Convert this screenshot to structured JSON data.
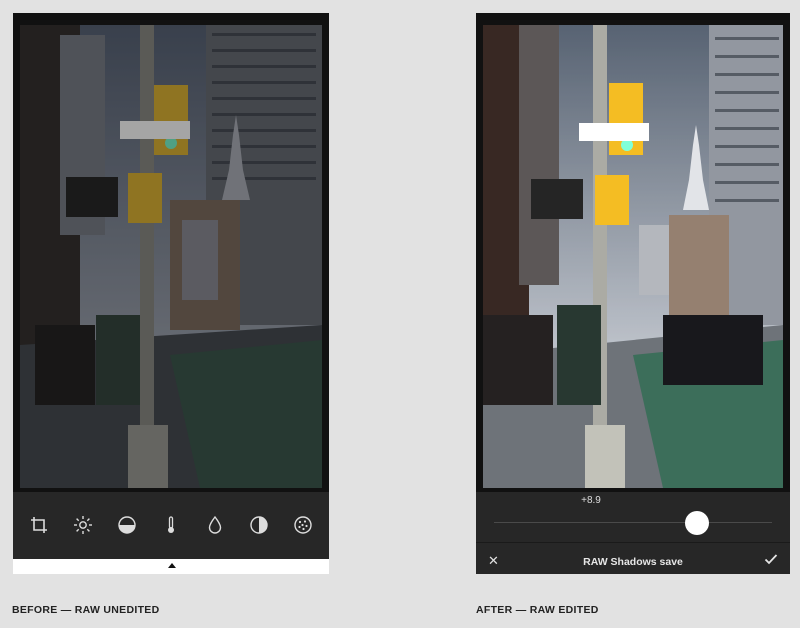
{
  "before_panel": {
    "caption": "BEFORE — RAW UNEDITED",
    "tools": [
      {
        "name": "crop-icon"
      },
      {
        "name": "brightness-icon"
      },
      {
        "name": "exposure-icon"
      },
      {
        "name": "temperature-icon"
      },
      {
        "name": "saturation-icon"
      },
      {
        "name": "contrast-icon"
      },
      {
        "name": "grain-icon"
      }
    ]
  },
  "after_panel": {
    "caption": "AFTER — RAW EDITED",
    "slider_value": "+8.9",
    "slider_level": 0.73,
    "tool_label": "RAW Shadows save",
    "cancel_label": "✕"
  },
  "colors": {
    "page_bg": "#e2e2e2",
    "bar_bg": "#272727",
    "knob": "#ffffff"
  }
}
